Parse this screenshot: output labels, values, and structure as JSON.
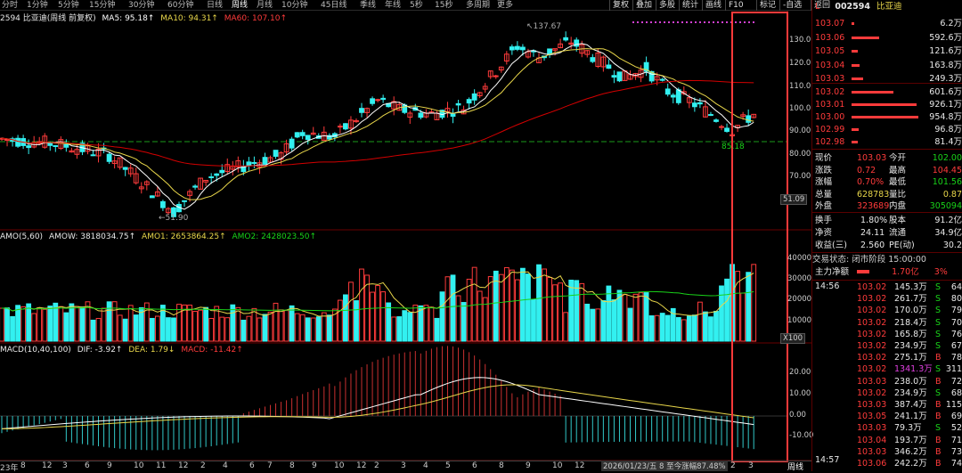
{
  "toolbar": {
    "periods": [
      "分时",
      "1分钟",
      "5分钟",
      "15分钟",
      "30分钟",
      "60分钟",
      "日线",
      "周线",
      "月线",
      "10分钟",
      "45日线",
      "季线",
      "年线",
      "5秒",
      "15秒",
      "多周期",
      "更多"
    ],
    "active": "周线",
    "right": [
      "复权",
      "叠加",
      "多股",
      "统计",
      "画线",
      "F10",
      "标记",
      "-自选",
      "返回"
    ]
  },
  "stock": {
    "title_left": "2594 比亚迪(周线 前复权)",
    "ma5": "MA5: 95.18↑",
    "ma10": "MA10: 94.31↑",
    "ma60": "MA60: 107.10↑",
    "high_label": "137.67",
    "low_label": "51.90",
    "recent_low_label": "85.18",
    "price_axis": [
      "130.0",
      "120.0",
      "110.0",
      "100.0",
      "90.00",
      "80.00",
      "70.00"
    ],
    "price_tag": "51.09",
    "colors": {
      "up": "#ff3b3b",
      "down": "#32f0f0",
      "ma5": "#ffffff",
      "ma10": "#e8d64a",
      "ma60": "#d40000",
      "macd_dif": "#ffffff",
      "macd_dea": "#e8d64a"
    }
  },
  "volume": {
    "header_name": "AMO(5,60)",
    "amow": "AMOW: 3818034.75↑",
    "amo1": "AMO1: 2653864.25↑",
    "amo2": "AMO2: 2428023.50↑",
    "axis": [
      "40000",
      "30000",
      "20000",
      "10000"
    ],
    "unit": "X100"
  },
  "macd": {
    "header_name": "MACD(10,40,100)",
    "dif": "DIF: -3.92↑",
    "dea": "DEA: 1.79↓",
    "macd": "MACD: -11.42↑",
    "axis": [
      "20.00",
      "10.00",
      "0.00",
      "-10.00"
    ]
  },
  "xaxis": {
    "labels": [
      "23年",
      "8",
      "12",
      "3",
      "6",
      "9",
      "10",
      "11",
      "12",
      "2",
      "4",
      "6",
      "7",
      "8",
      "9",
      "10",
      "12",
      "2",
      "3",
      "4",
      "5",
      "6",
      "8",
      "9",
      "10",
      "12",
      "2",
      "3"
    ],
    "cursor_info": "2026/01/23/五 8 至今涨幅87.48%",
    "period_tab": "周线"
  },
  "right_panel": {
    "code": "002594",
    "name": "比亚迪",
    "asks": [
      {
        "price": "103.07",
        "vol": "6.2万",
        "pct": 6
      },
      {
        "price": "103.06",
        "vol": "592.6万",
        "pct": 62
      },
      {
        "price": "103.05",
        "vol": "121.6万",
        "pct": 13
      },
      {
        "price": "103.04",
        "vol": "163.8万",
        "pct": 17
      },
      {
        "price": "103.03",
        "vol": "249.3万",
        "pct": 26
      }
    ],
    "bids": [
      {
        "price": "103.02",
        "vol": "601.6万",
        "pct": 63
      },
      {
        "price": "103.01",
        "vol": "926.1万",
        "pct": 97
      },
      {
        "price": "103.00",
        "vol": "954.8万",
        "pct": 100
      },
      {
        "price": "102.99",
        "vol": "96.8万",
        "pct": 10
      },
      {
        "price": "102.98",
        "vol": "81.4万",
        "pct": 9
      }
    ],
    "quote": [
      {
        "l1": "现价",
        "v1": "103.03",
        "c1": "red",
        "l2": "今开",
        "v2": "102.00",
        "c2": "grn"
      },
      {
        "l1": "涨跌",
        "v1": "0.72",
        "c1": "red",
        "l2": "最高",
        "v2": "104.45",
        "c2": "red"
      },
      {
        "l1": "涨幅",
        "v1": "0.70%",
        "c1": "red",
        "l2": "最低",
        "v2": "101.56",
        "c2": "grn"
      },
      {
        "l1": "总量",
        "v1": "628783",
        "c1": "yel",
        "l2": "量比",
        "v2": "0.87",
        "c2": "yel"
      },
      {
        "l1": "外盘",
        "v1": "323689",
        "c1": "red",
        "l2": "内盘",
        "v2": "305094",
        "c2": "grn"
      }
    ],
    "stats": [
      {
        "l1": "换手",
        "v1": "1.80%",
        "l2": "股本",
        "v2": "91.2亿"
      },
      {
        "l1": "净资",
        "v1": "24.11",
        "l2": "流通",
        "v2": "34.9亿"
      },
      {
        "l1": "收益(三)",
        "v1": "2.560",
        "l2": "PE(动)",
        "v2": "30.2"
      }
    ],
    "trade_status": "交易状态: 闭市阶段 15:00:00",
    "main_flow": {
      "label": "主力净额",
      "value": "1.70亿",
      "pct": "3%"
    },
    "ticks_time_start": "14:56",
    "ticks_time_end": "14:57",
    "ticks": [
      {
        "p": "103.02",
        "v": "145.3万",
        "s": "S",
        "n": "64"
      },
      {
        "p": "103.02",
        "v": "261.7万",
        "s": "S",
        "n": "80"
      },
      {
        "p": "103.02",
        "v": "170.0万",
        "s": "S",
        "n": "79"
      },
      {
        "p": "103.02",
        "v": "218.4万",
        "s": "S",
        "n": "70"
      },
      {
        "p": "103.02",
        "v": "165.8万",
        "s": "S",
        "n": "76"
      },
      {
        "p": "103.02",
        "v": "234.9万",
        "s": "S",
        "n": "67"
      },
      {
        "p": "103.02",
        "v": "275.1万",
        "s": "B",
        "n": "78"
      },
      {
        "p": "103.02",
        "v": "1341.3万",
        "s": "S",
        "n": "311"
      },
      {
        "p": "103.03",
        "v": "238.0万",
        "s": "B",
        "n": "72"
      },
      {
        "p": "103.02",
        "v": "234.9万",
        "s": "S",
        "n": "68"
      },
      {
        "p": "103.03",
        "v": "387.4万",
        "s": "B",
        "n": "115"
      },
      {
        "p": "103.05",
        "v": "241.1万",
        "s": "B",
        "n": "69"
      },
      {
        "p": "103.03",
        "v": "79.3万",
        "s": "S",
        "n": "52"
      },
      {
        "p": "103.04",
        "v": "193.7万",
        "s": "B",
        "n": "71"
      },
      {
        "p": "103.03",
        "v": "346.2万",
        "s": "B",
        "n": "73"
      },
      {
        "p": "103.06",
        "v": "242.2万",
        "s": "B",
        "n": "74"
      }
    ]
  }
}
